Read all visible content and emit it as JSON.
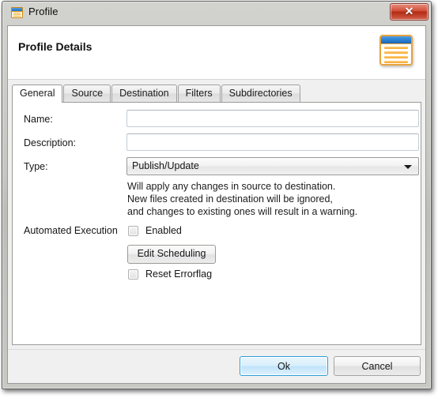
{
  "window": {
    "title": "Profile",
    "icon": "window-form-icon",
    "close_label": "✕"
  },
  "header": {
    "title": "Profile Details",
    "icon": "document-lines-icon"
  },
  "tabs": [
    {
      "label": "General",
      "active": true
    },
    {
      "label": "Source",
      "active": false
    },
    {
      "label": "Destination",
      "active": false
    },
    {
      "label": "Filters",
      "active": false
    },
    {
      "label": "Subdirectories",
      "active": false
    }
  ],
  "form": {
    "name": {
      "label": "Name:",
      "value": "",
      "placeholder": ""
    },
    "description": {
      "label": "Description:",
      "value": "",
      "placeholder": ""
    },
    "type": {
      "label": "Type:",
      "value": "Publish/Update",
      "options": [
        "Publish/Update"
      ]
    },
    "type_description": [
      "Will apply any changes in source to destination.",
      "New files created in destination will be ignored,",
      "and changes to existing ones will result in a warning."
    ],
    "automated_execution": {
      "label": "Automated Execution",
      "enabled": {
        "label": "Enabled",
        "checked": false
      },
      "edit_scheduling": {
        "label": "Edit Scheduling"
      },
      "reset_errorflag": {
        "label": "Reset Errorflag",
        "checked": false
      }
    }
  },
  "footer": {
    "ok_label": "Ok",
    "cancel_label": "Cancel"
  },
  "colors": {
    "accent_blue": "#2c9fd9",
    "close_red": "#b32b14",
    "icon_orange": "#e8a33d",
    "icon_blue": "#2a7fd0"
  }
}
